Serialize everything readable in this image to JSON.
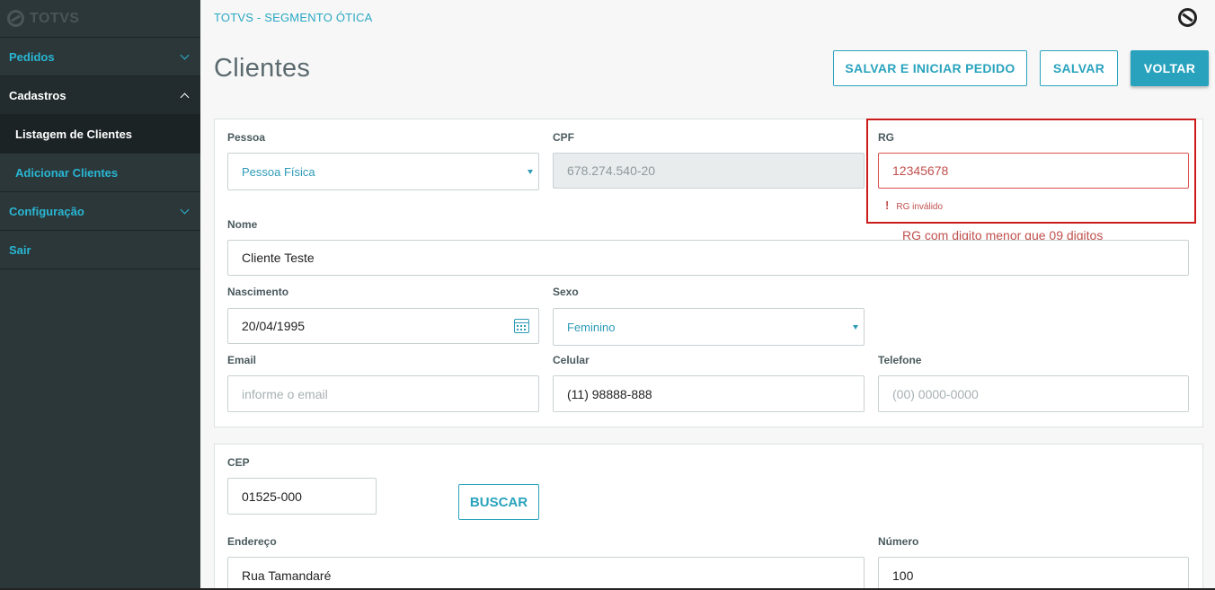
{
  "sidebar": {
    "logo": "TOTVS",
    "items": [
      {
        "label": "Pedidos"
      },
      {
        "label": "Cadastros"
      },
      {
        "label": "Listagem de Clientes"
      },
      {
        "label": "Adicionar Clientes"
      },
      {
        "label": "Configuração"
      },
      {
        "label": "Sair"
      }
    ]
  },
  "header": {
    "breadcrumb": "TOTVS - SEGMENTO ÓTICA",
    "title": "Clientes",
    "buttons": {
      "save_start": "SALVAR E INICIAR PEDIDO",
      "save": "SALVAR",
      "back": "VOLTAR"
    }
  },
  "form": {
    "pessoa": {
      "label": "Pessoa",
      "value": "Pessoa Física"
    },
    "cpf": {
      "label": "CPF",
      "value": "678.274.540-20"
    },
    "rg": {
      "label": "RG",
      "value": "12345678",
      "error": "RG inválido"
    },
    "annotation": "RG com digito menor que 09 digitos",
    "nome": {
      "label": "Nome",
      "value": "Cliente Teste"
    },
    "nascimento": {
      "label": "Nascimento",
      "value": "20/04/1995"
    },
    "sexo": {
      "label": "Sexo",
      "value": "Feminino"
    },
    "email": {
      "label": "Email",
      "placeholder": "informe o email"
    },
    "celular": {
      "label": "Celular",
      "value": "(11) 98888-888"
    },
    "telefone": {
      "label": "Telefone",
      "placeholder": "(00) 0000-0000"
    }
  },
  "address": {
    "cep": {
      "label": "CEP",
      "value": "01525-000"
    },
    "buscar": "BUSCAR",
    "endereco": {
      "label": "Endereço",
      "value": "Rua Tamandaré"
    },
    "numero": {
      "label": "Número",
      "value": "100"
    }
  },
  "colors": {
    "accent": "#29a3bd",
    "sidebar": "#2c3739",
    "error": "#c0504d"
  }
}
